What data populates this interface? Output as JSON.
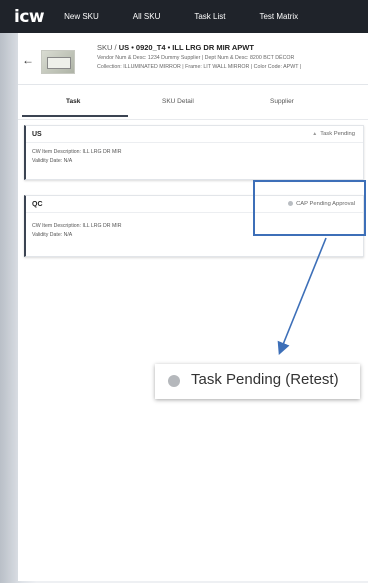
{
  "nav": {
    "logo": "icw",
    "items": [
      "New SKU",
      "All SKU",
      "Task List",
      "Test Matrix"
    ]
  },
  "sku": {
    "back_icon": "arrow-left-icon",
    "prefix": "SKU /",
    "title": "US • 0920_T4 • ILL LRG DR MIR APWT",
    "line1": "Vendor Num & Desc: 1234 Dummy Supplier | Dept Num & Desc: 8200 BCT DÉCOR",
    "line2": "Collection: ILLUMINATED MIRROR | Frame: LIT WALL MIRROR | Color Code: APWT |"
  },
  "tabs": [
    "Task",
    "SKU Detail",
    "Supplier"
  ],
  "cards": [
    {
      "title": "US",
      "status": "Task Pending",
      "status_icon": "warning-triangle-icon",
      "desc": "CW Item Description: ILL LRG DR MIR",
      "validity": "Validity Date: N/A"
    },
    {
      "title": "QC",
      "status": "CAP Pending Approval",
      "status_icon": "gray-dot-icon",
      "desc": "CW Item Description: ILL LRG DR MIR",
      "validity": "Validity Date: N/A"
    }
  ],
  "callout": {
    "text": "Task Pending (Retest)",
    "icon": "gray-dot-icon"
  },
  "colors": {
    "topbar": "#1f232a",
    "highlight": "#3d6fb8",
    "accent": "#3b4452"
  }
}
